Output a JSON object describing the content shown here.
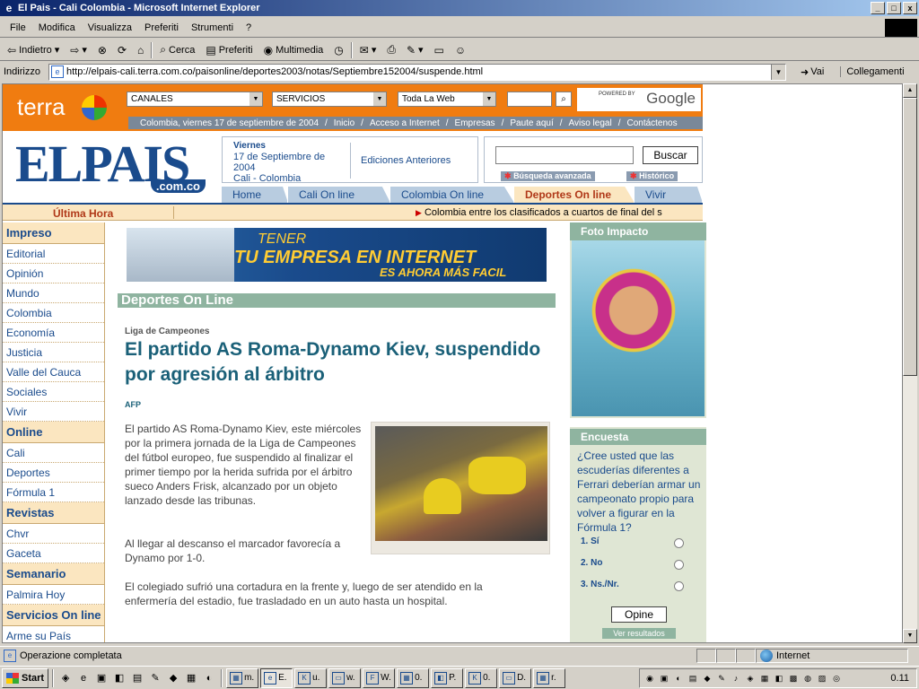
{
  "window": {
    "title": "El Pais - Cali Colombia - Microsoft Internet Explorer",
    "min": "_",
    "max": "□",
    "close": "x"
  },
  "menu": [
    "File",
    "Modifica",
    "Visualizza",
    "Preferiti",
    "Strumenti",
    "?"
  ],
  "toolbar": {
    "back": "Indietro",
    "search": "Cerca",
    "favorites": "Preferiti",
    "media": "Multimedia"
  },
  "address": {
    "label": "Indirizzo",
    "url": "http://elpais-cali.terra.com.co/paisonline/deportes2003/notas/Septiembre152004/suspende.html",
    "go": "Vai",
    "links": "Collegamenti"
  },
  "terra": {
    "logo": "terra",
    "select1": "CANALES",
    "select2": "SERVICIOS",
    "select3": "Toda La Web",
    "powered": "POWERED BY",
    "google": "Google",
    "links": [
      "Colombia, viernes 17 de septiembre de 2004",
      "Inicio",
      "Acceso a Internet",
      "Empresas",
      "Paute aquí",
      "Aviso legal",
      "Contáctenos"
    ]
  },
  "header": {
    "logo_word": "ELPAIS",
    "logo_domain": ".com.co",
    "day": "Viernes",
    "date": "17 de Septiembre de 2004",
    "city": "Cali - Colombia",
    "editions": "Ediciones Anteriores",
    "search_button": "Buscar",
    "advanced": "Búsqueda avanzada",
    "history": "Histórico"
  },
  "nav": {
    "tabs": [
      "Home",
      "Cali On line",
      "Colombia On line",
      "Deportes On line",
      "Vivir"
    ]
  },
  "ticker": {
    "label": "Última Hora",
    "text": "Colombia entre los clasificados a cuartos de final del s"
  },
  "leftmenu": {
    "items": [
      {
        "label": "Impreso",
        "head": true
      },
      {
        "label": "Editorial",
        "head": false
      },
      {
        "label": "Opinión",
        "head": false
      },
      {
        "label": "Mundo",
        "head": false
      },
      {
        "label": "Colombia",
        "head": false
      },
      {
        "label": "Economía",
        "head": false
      },
      {
        "label": "Justicia",
        "head": false
      },
      {
        "label": "Valle del Cauca",
        "head": false
      },
      {
        "label": "Sociales",
        "head": false
      },
      {
        "label": "Vivir",
        "head": false
      },
      {
        "label": "Online",
        "head": true
      },
      {
        "label": "Cali",
        "head": false
      },
      {
        "label": "Deportes",
        "head": false
      },
      {
        "label": "Fórmula 1",
        "head": false
      },
      {
        "label": "Revistas",
        "head": true
      },
      {
        "label": "Chvr",
        "head": false
      },
      {
        "label": "Gaceta",
        "head": false
      },
      {
        "label": "Semanario",
        "head": true
      },
      {
        "label": "Palmira Hoy",
        "head": false
      },
      {
        "label": "Servicios On line",
        "head": true
      },
      {
        "label": "Arme su País",
        "head": false
      }
    ]
  },
  "banner": {
    "line1": "TENER",
    "line2": "TU EMPRESA EN INTERNET",
    "line3": "ES AHORA MÁS FACIL"
  },
  "section": "Deportes On Line",
  "article": {
    "kicker": "Liga de Campeones",
    "headline": "El partido AS Roma-Dynamo Kiev, suspendido por agresión al árbitro",
    "source": "AFP",
    "p1": "El partido AS Roma-Dynamo Kiev, este miércoles por la primera jornada de la Liga de Campeones del fútbol europeo, fue suspendido al finalizar el primer tiempo por la herida sufrida por el árbitro sueco Anders Frisk, alcanzado por un objeto lanzado desde las tribunas.",
    "p2": "Al llegar al descanso el marcador favorecía a Dynamo por 1-0.",
    "p3": "El colegiado sufrió una cortadura en la frente y, luego de ser atendido en la enfermería del estadio, fue trasladado en un auto hasta un hospital."
  },
  "right": {
    "photo_title": "Foto Impacto",
    "poll_title": "Encuesta",
    "question": "¿Cree usted que las escuderías diferentes a Ferrari deberían armar un campeonato propio para volver a figurar en la Fórmula 1?",
    "options": [
      "1. Sí",
      "2. No",
      "3. Ns./Nr."
    ],
    "vote": "Opine",
    "results": "Ver resultados"
  },
  "status": {
    "text": "Operazione completata",
    "zone": "Internet"
  },
  "taskbar": {
    "start": "Start",
    "tasks": [
      "m.",
      "E.",
      "u.",
      "w.",
      "W.",
      "0.",
      "P.",
      "0.",
      "D.",
      "r."
    ],
    "clock": "0.11"
  }
}
